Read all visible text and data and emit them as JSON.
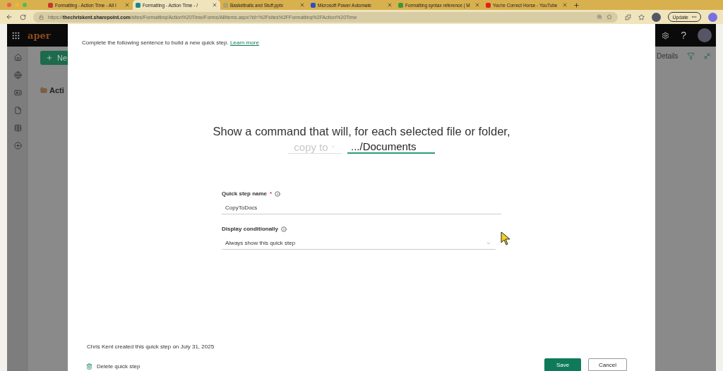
{
  "browser": {
    "tabs": [
      {
        "label": "Formatting - Action Time - All I",
        "selected": false,
        "color": "#c0392b"
      },
      {
        "label": "Formatting - Action Time - /",
        "selected": true,
        "color": "#138a8a"
      },
      {
        "label": "Basketballs and Stuff.pptx",
        "selected": false,
        "color": "#b0a070"
      },
      {
        "label": "Microsoft Power Automate",
        "selected": false,
        "color": "#2b4fc7"
      },
      {
        "label": "Formatting syntax reference | M",
        "selected": false,
        "color": "#3a9a3a"
      },
      {
        "label": "You're Correct Horse - YouTube",
        "selected": false,
        "color": "#e02020"
      }
    ],
    "url": "https://**thechriskent.sharepoint.com**/sites/Formatting/Action%20Time/Forms/AllItems.aspx?id=%2Fsites%2FFormatting%2FAction%20Time",
    "update_button": "Update"
  },
  "suite_bar": {
    "logo_text": "aper",
    "help": "?"
  },
  "command_bar": {
    "new_button": "Ne",
    "details": "Details"
  },
  "list_title": "Acti",
  "dialog": {
    "subtitle": "Complete the following sentence to build a new quick step.",
    "learn_more": "Learn more",
    "sentence": "Show a command that will, for each selected file or folder,",
    "action": {
      "value": "copy to",
      "disabled": true
    },
    "target": ".../Documents",
    "fields": [
      {
        "kind": "text",
        "label": "Quick step name",
        "required_mark": "*",
        "value": "CopyToDocs"
      },
      {
        "kind": "dropdown",
        "label": "Display conditionally",
        "value": "Always show this quick step"
      }
    ],
    "created_note": "Chris Kent created this quick step on July 31, 2025",
    "delete_link": "Delete quick step",
    "buttons": [
      {
        "label": "Save",
        "primary": true
      },
      {
        "label": "Cancel",
        "primary": false
      }
    ]
  }
}
